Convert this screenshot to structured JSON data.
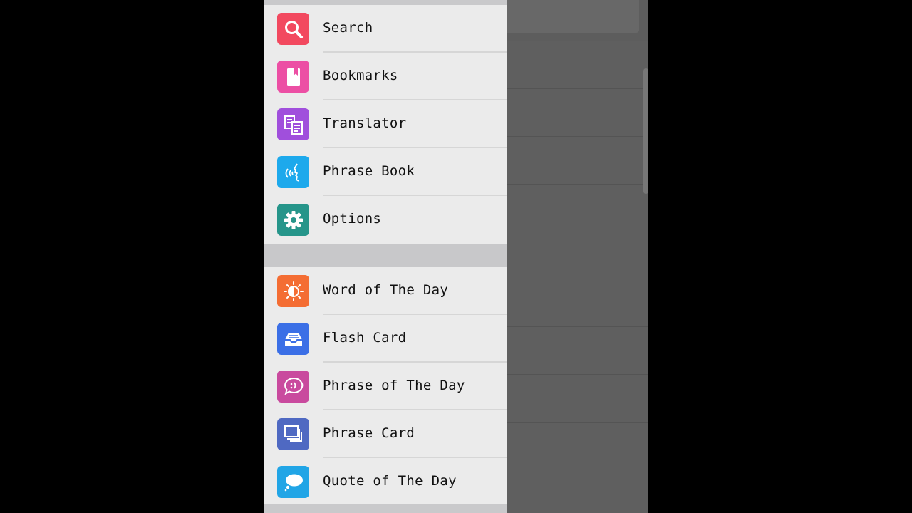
{
  "drawer": {
    "primary_items": [
      {
        "label": "Search",
        "icon": "search-icon",
        "color": "#f2495f"
      },
      {
        "label": "Bookmarks",
        "icon": "bookmark-icon",
        "color": "#ec4fa4"
      },
      {
        "label": "Translator",
        "icon": "translator-icon",
        "color": "#a04fdc"
      },
      {
        "label": "Phrase Book",
        "icon": "speaking-head-icon",
        "color": "#1da9ec"
      },
      {
        "label": "Options",
        "icon": "gear-icon",
        "color": "#26958a"
      }
    ],
    "secondary_items": [
      {
        "label": "Word of The Day",
        "icon": "sun-icon",
        "color": "#f46d33"
      },
      {
        "label": "Flash Card",
        "icon": "inbox-tray-icon",
        "color": "#3b6fe6"
      },
      {
        "label": "Phrase of The Day",
        "icon": "speech-bubble-icon",
        "color": "#c94a9e"
      },
      {
        "label": "Phrase Card",
        "icon": "stacked-cards-icon",
        "color": "#4f69c2"
      },
      {
        "label": "Quote of The Day",
        "icon": "chat-bubble-icon",
        "color": "#21a5e6"
      }
    ]
  }
}
